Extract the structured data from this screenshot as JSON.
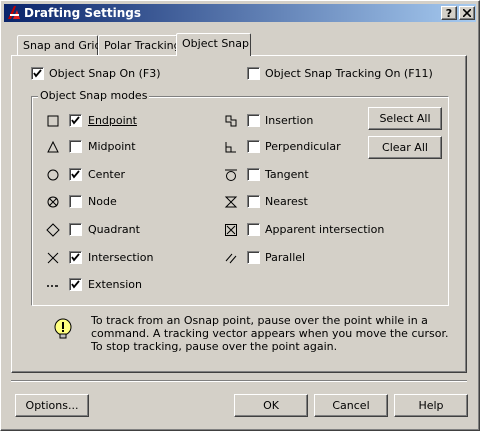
{
  "window": {
    "title": "Drafting Settings",
    "help_btn": "?",
    "close_btn": "X"
  },
  "tabs": [
    {
      "label": "Snap and Grid",
      "active": false
    },
    {
      "label": "Polar Tracking",
      "active": false
    },
    {
      "label": "Object Snap",
      "active": true
    }
  ],
  "options": {
    "snap_on": {
      "label": "Object Snap On (F3)",
      "checked": true
    },
    "tracking_on": {
      "label": "Object Snap Tracking On (F11)",
      "checked": false
    }
  },
  "modes": {
    "group_label": "Object Snap modes",
    "left": [
      {
        "label": "Endpoint",
        "checked": true,
        "icon": "square-icon"
      },
      {
        "label": "Midpoint",
        "checked": false,
        "icon": "triangle-icon"
      },
      {
        "label": "Center",
        "checked": true,
        "icon": "circle-icon"
      },
      {
        "label": "Node",
        "checked": false,
        "icon": "node-icon"
      },
      {
        "label": "Quadrant",
        "checked": false,
        "icon": "diamond-icon"
      },
      {
        "label": "Intersection",
        "checked": true,
        "icon": "x-icon"
      },
      {
        "label": "Extension",
        "checked": true,
        "icon": "extension-icon"
      }
    ],
    "right": [
      {
        "label": "Insertion",
        "checked": false,
        "icon": "insertion-icon"
      },
      {
        "label": "Perpendicular",
        "checked": false,
        "icon": "perpendicular-icon"
      },
      {
        "label": "Tangent",
        "checked": false,
        "icon": "tangent-icon"
      },
      {
        "label": "Nearest",
        "checked": false,
        "icon": "hourglass-icon"
      },
      {
        "label": "Apparent intersection",
        "checked": false,
        "icon": "boxed-x-icon"
      },
      {
        "label": "Parallel",
        "checked": false,
        "icon": "parallel-icon"
      }
    ],
    "select_all": "Select All",
    "clear_all": "Clear All"
  },
  "info": {
    "line1": "To track from an Osnap point, pause over the point while in a",
    "line2": "command.  A tracking vector appears when you move the cursor.",
    "line3": "To stop tracking, pause over the point again."
  },
  "footer": {
    "options": "Options...",
    "ok": "OK",
    "cancel": "Cancel",
    "help": "Help"
  }
}
